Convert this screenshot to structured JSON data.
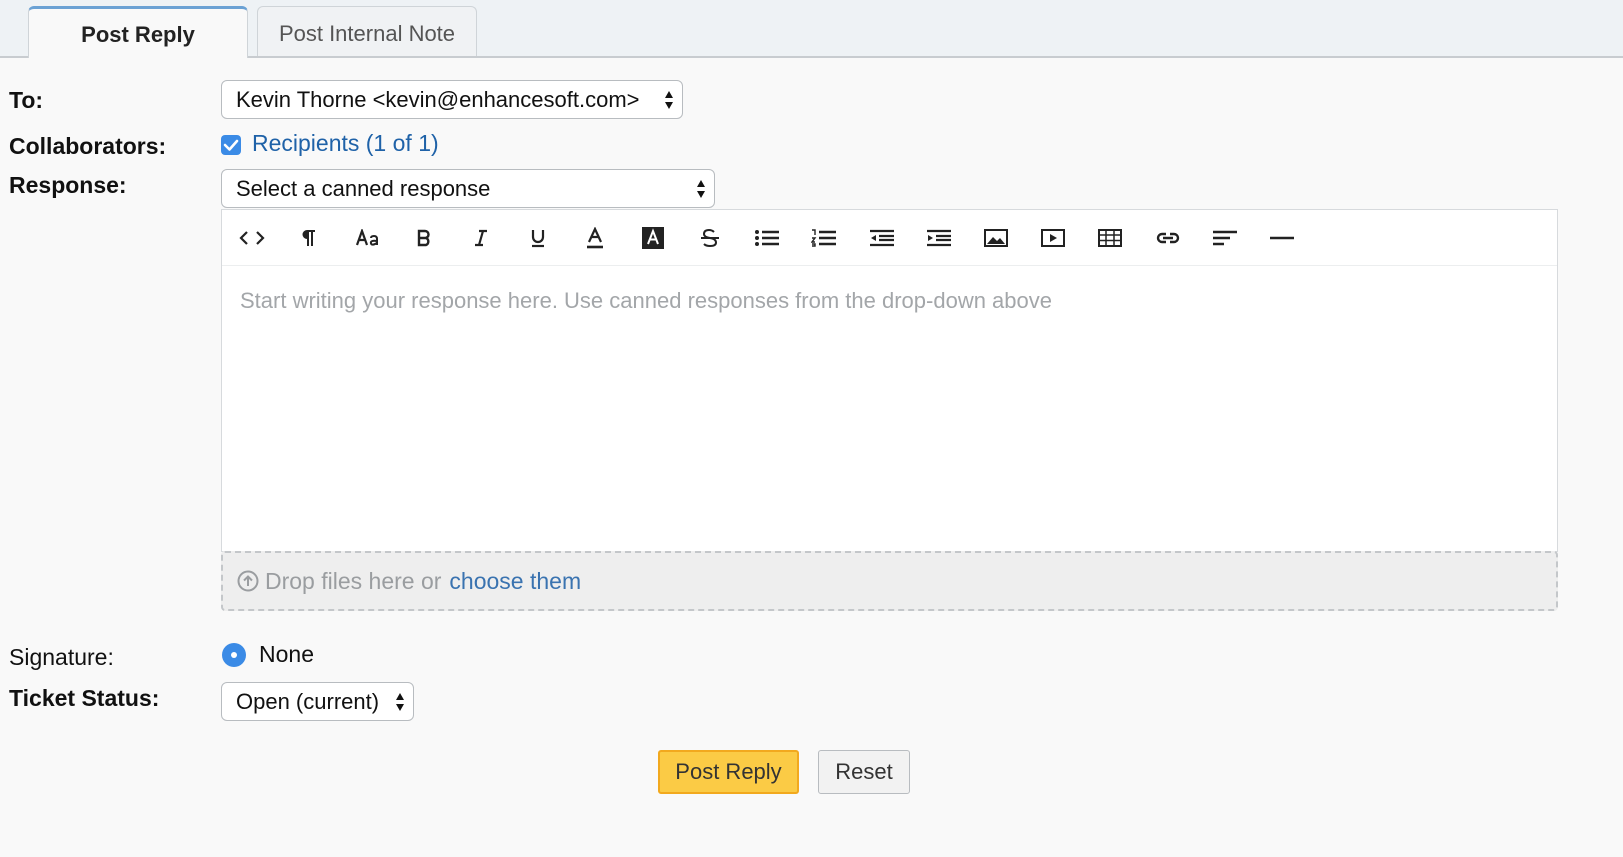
{
  "tabs": {
    "post_reply": "Post Reply",
    "internal_note": "Post Internal Note"
  },
  "fields": {
    "to_label": "To:",
    "to_value": "Kevin Thorne <kevin@enhancesoft.com>",
    "collaborators_label": "Collaborators:",
    "collaborators_checked": true,
    "recipients_link": "Recipients (1 of 1)",
    "response_label": "Response:",
    "response_value": "Select a canned response",
    "signature_label": "Signature:",
    "signature_value": "None",
    "status_label": "Ticket Status:",
    "status_value": "Open (current)"
  },
  "editor": {
    "placeholder": "Start writing your response here. Use canned responses from the drop-down above",
    "toolbar": [
      "html-code-icon",
      "paragraph-icon",
      "font-size-icon",
      "bold-icon",
      "italic-icon",
      "underline-icon",
      "font-color-icon",
      "background-color-icon",
      "strikethrough-icon",
      "unordered-list-icon",
      "ordered-list-icon",
      "outdent-icon",
      "indent-icon",
      "image-icon",
      "video-icon",
      "table-icon",
      "link-icon",
      "align-icon",
      "horizontal-rule-icon"
    ]
  },
  "dropzone": {
    "text": "Drop files here or",
    "link": "choose them"
  },
  "buttons": {
    "submit": "Post Reply",
    "reset": "Reset"
  },
  "colors": {
    "accent": "#3b8be6",
    "submit_bg": "#fbcb45",
    "link": "#1f62a8"
  }
}
